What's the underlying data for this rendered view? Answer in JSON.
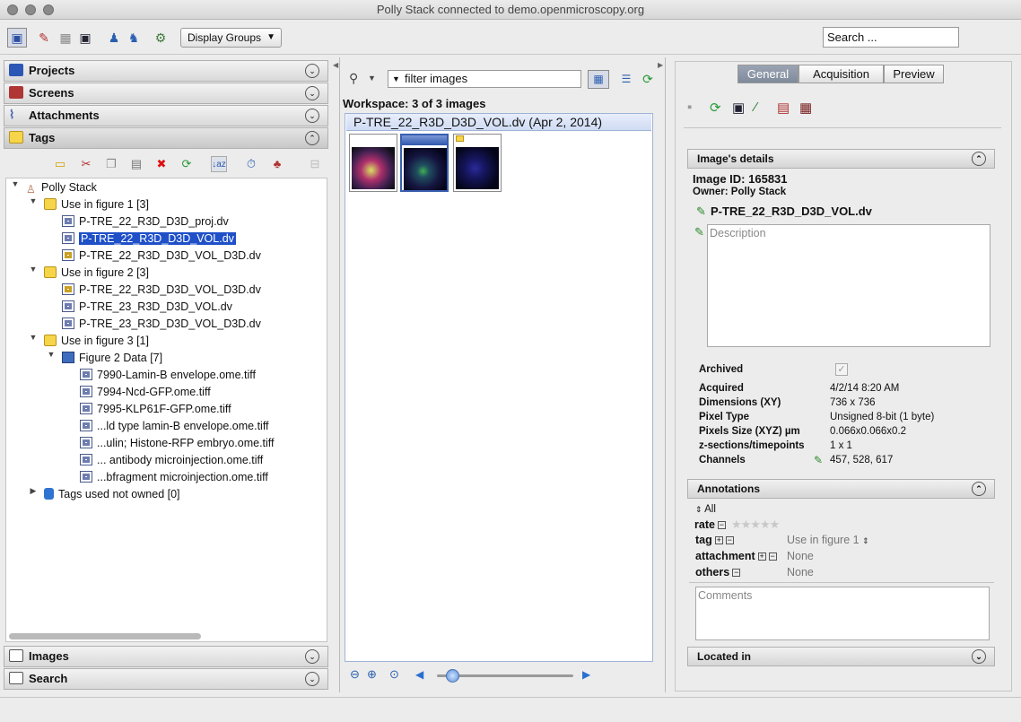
{
  "window": {
    "title": "Polly Stack connected to demo.openmicroscopy.org"
  },
  "toolbar": {
    "display_groups": "Display Groups",
    "search_placeholder": "Search ..."
  },
  "left": {
    "accordions": {
      "projects": "Projects",
      "screens": "Screens",
      "attachments": "Attachments",
      "tags": "Tags",
      "images": "Images",
      "search": "Search"
    },
    "tree": {
      "root": "Polly Stack",
      "f1": "Use in figure 1 [3]",
      "f1_items": [
        "P-TRE_22_R3D_D3D_proj.dv",
        "P-TRE_22_R3D_D3D_VOL.dv",
        "P-TRE_22_R3D_D3D_VOL_D3D.dv"
      ],
      "f2": "Use in figure 2 [3]",
      "f2_items": [
        "P-TRE_22_R3D_D3D_VOL_D3D.dv",
        "P-TRE_23_R3D_D3D_VOL.dv",
        "P-TRE_23_R3D_D3D_VOL_D3D.dv"
      ],
      "f3": "Use in figure 3 [1]",
      "f3_sub": "Figure 2 Data [7]",
      "f3_items": [
        "7990-Lamin-B envelope.ome.tiff",
        "7994-Ncd-GFP.ome.tiff",
        "7995-KLP61F-GFP.ome.tiff",
        "...ld type lamin-B envelope.ome.tiff",
        "...ulin; Histone-RFP embryo.ome.tiff",
        "... antibody microinjection.ome.tiff",
        "...bfragment microinjection.ome.tiff"
      ],
      "notowned": "Tags used not owned [0]"
    }
  },
  "center": {
    "filter": "filter  images",
    "workspace": "Workspace: 3 of 3 images",
    "header": "P-TRE_22_R3D_D3D_VOL.dv (Apr 2, 2014)"
  },
  "right": {
    "tabs": {
      "general": "General",
      "acquisition": "Acquisition",
      "preview": "Preview"
    },
    "details_title": "Image's details",
    "image_id": "Image ID: 165831",
    "owner": "Owner: Polly Stack",
    "name": "P-TRE_22_R3D_D3D_VOL.dv",
    "description_placeholder": "Description",
    "fields": {
      "archived": "Archived",
      "acquired_l": "Acquired",
      "acquired": "4/2/14 8:20 AM",
      "dims_l": "Dimensions (XY)",
      "dims": "736 x 736",
      "ptype_l": "Pixel Type",
      "ptype": "Unsigned 8-bit (1 byte)",
      "psize_l": "Pixels Size (XYZ) µm",
      "psize": "0.066x0.066x0.2",
      "zt_l": "z-sections/timepoints",
      "zt": "1 x 1",
      "ch_l": "Channels",
      "ch": "457, 528, 617"
    },
    "annotations_title": "Annotations",
    "ann": {
      "all": "All",
      "rate": "rate",
      "tag": "tag",
      "tag_value": "Use in figure 1",
      "attachment": "attachment",
      "attachment_value": "None",
      "others": "others",
      "others_value": "None"
    },
    "comments_placeholder": "Comments",
    "located_title": "Located in"
  }
}
